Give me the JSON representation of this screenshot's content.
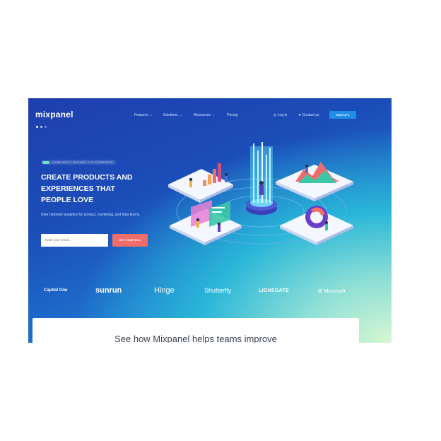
{
  "brand": {
    "logo_text": "mixpanel"
  },
  "nav": {
    "items": [
      {
        "label": "Features",
        "chevron": "⌄"
      },
      {
        "label": "Solutions",
        "chevron": "⌄"
      },
      {
        "label": "Resources",
        "chevron": "⌄"
      },
      {
        "label": "Pricing"
      }
    ],
    "login": "Log in",
    "contact": "Contact us",
    "signup": "SIGN UP"
  },
  "hero": {
    "badge": "LEARN ABOUT MIXPANEL FOR ENTERPRISE",
    "title_lines": [
      "CREATE PRODUCTS AND",
      "EXPERIENCES THAT",
      "PEOPLE LOVE"
    ],
    "subtitle": "User behavior analytics for product, marketing, and data teams.",
    "email_placeholder": "Enter your email...",
    "cta": "GET STARTED"
  },
  "customers": [
    "Capital One",
    "sunrun",
    "Hinge",
    "Shutterfly",
    "LIONSGATE",
    "Microsoft"
  ],
  "section": {
    "title": "See how Mixpanel helps teams improve"
  },
  "colors": {
    "signup": "#1f8ee8",
    "cta": "#ee6d6a",
    "accent_teal": "#6fe0c4"
  }
}
